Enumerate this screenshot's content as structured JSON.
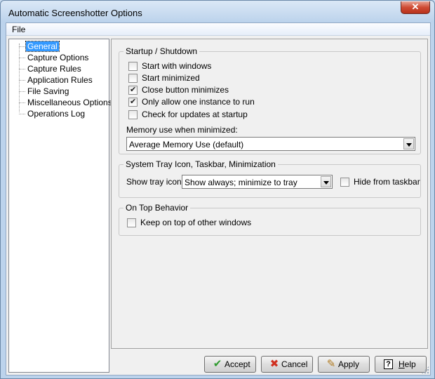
{
  "window": {
    "title": "Automatic Screenshotter Options"
  },
  "menu": {
    "file_label": "File"
  },
  "tree": {
    "items": [
      {
        "label": "General",
        "selected": true
      },
      {
        "label": "Capture Options"
      },
      {
        "label": "Capture Rules"
      },
      {
        "label": "Application Rules"
      },
      {
        "label": "File Saving"
      },
      {
        "label": "Miscellaneous Options"
      },
      {
        "label": "Operations Log"
      }
    ]
  },
  "startup": {
    "legend": "Startup / Shutdown",
    "options": [
      {
        "label": "Start with windows",
        "checked": false
      },
      {
        "label": "Start minimized",
        "checked": false
      },
      {
        "label": "Close button minimizes",
        "checked": true
      },
      {
        "label": "Only allow one instance to run",
        "checked": true
      },
      {
        "label": "Check for updates at startup",
        "checked": false
      }
    ],
    "memory_label": "Memory use when minimized:",
    "memory_value": "Average Memory Use (default)"
  },
  "tray": {
    "legend": "System Tray Icon, Taskbar, Minimization",
    "show_label": "Show tray icon:",
    "show_value": "Show always; minimize to tray",
    "hide_label": "Hide from taskbar",
    "hide_checked": false
  },
  "ontop": {
    "legend": "On Top Behavior",
    "keep_label": "Keep on top of other windows",
    "keep_checked": false
  },
  "buttons": {
    "accept": "Accept",
    "cancel": "Cancel",
    "apply": "Apply",
    "help": "Help"
  },
  "icons": {
    "accept": "check-icon",
    "cancel": "cross-icon",
    "apply": "pencil-icon",
    "help": "question-icon"
  },
  "colors": {
    "accept_icon": "#2f9a2f",
    "cancel_icon": "#d03020",
    "selection": "#3399ff"
  }
}
